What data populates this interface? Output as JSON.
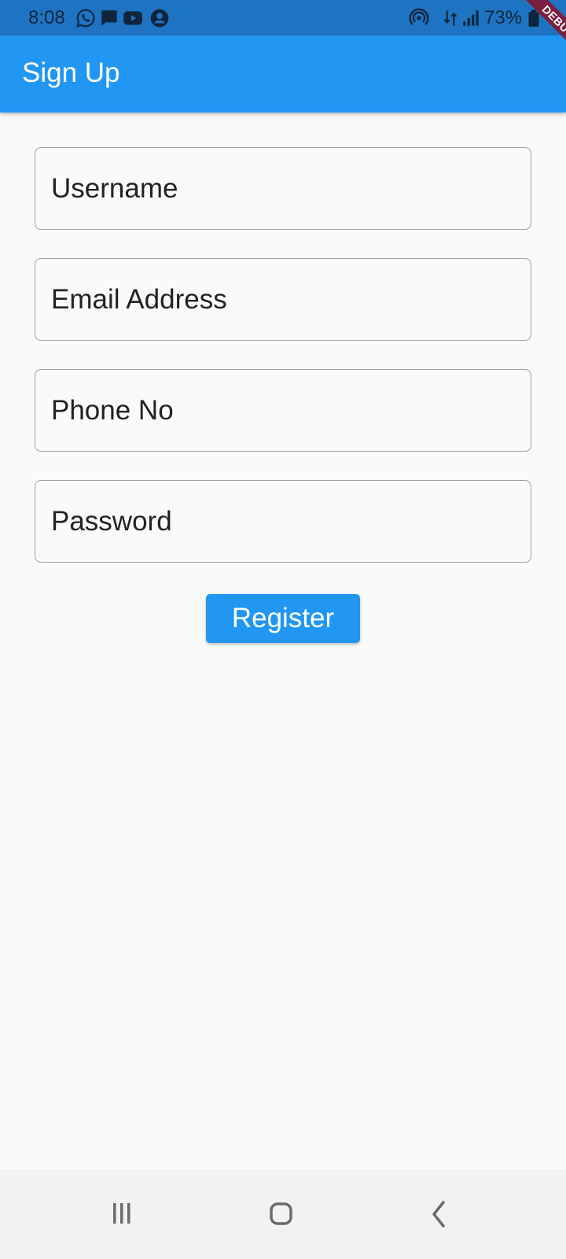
{
  "status_bar": {
    "time": "8:08",
    "battery": "73%",
    "icons": [
      "whatsapp-icon",
      "message-icon",
      "youtube-icon",
      "account-icon",
      "hotspot-icon",
      "data-transfer-icon",
      "signal-icon",
      "battery-icon"
    ]
  },
  "debug_banner": "DEBUG",
  "app_bar": {
    "title": "Sign Up"
  },
  "form": {
    "username_placeholder": "Username",
    "email_placeholder": "Email Address",
    "phone_placeholder": "Phone No",
    "password_placeholder": "Password",
    "register_label": "Register"
  },
  "nav_bar": {
    "buttons": [
      "recent-apps",
      "home",
      "back"
    ]
  },
  "colors": {
    "status_bar": "#1e74c3",
    "app_bar": "#2196f3",
    "background": "#fafafa",
    "button": "#2196f3",
    "nav_bar": "#f2f2f2",
    "debug_ribbon": "#7a1f3d"
  }
}
